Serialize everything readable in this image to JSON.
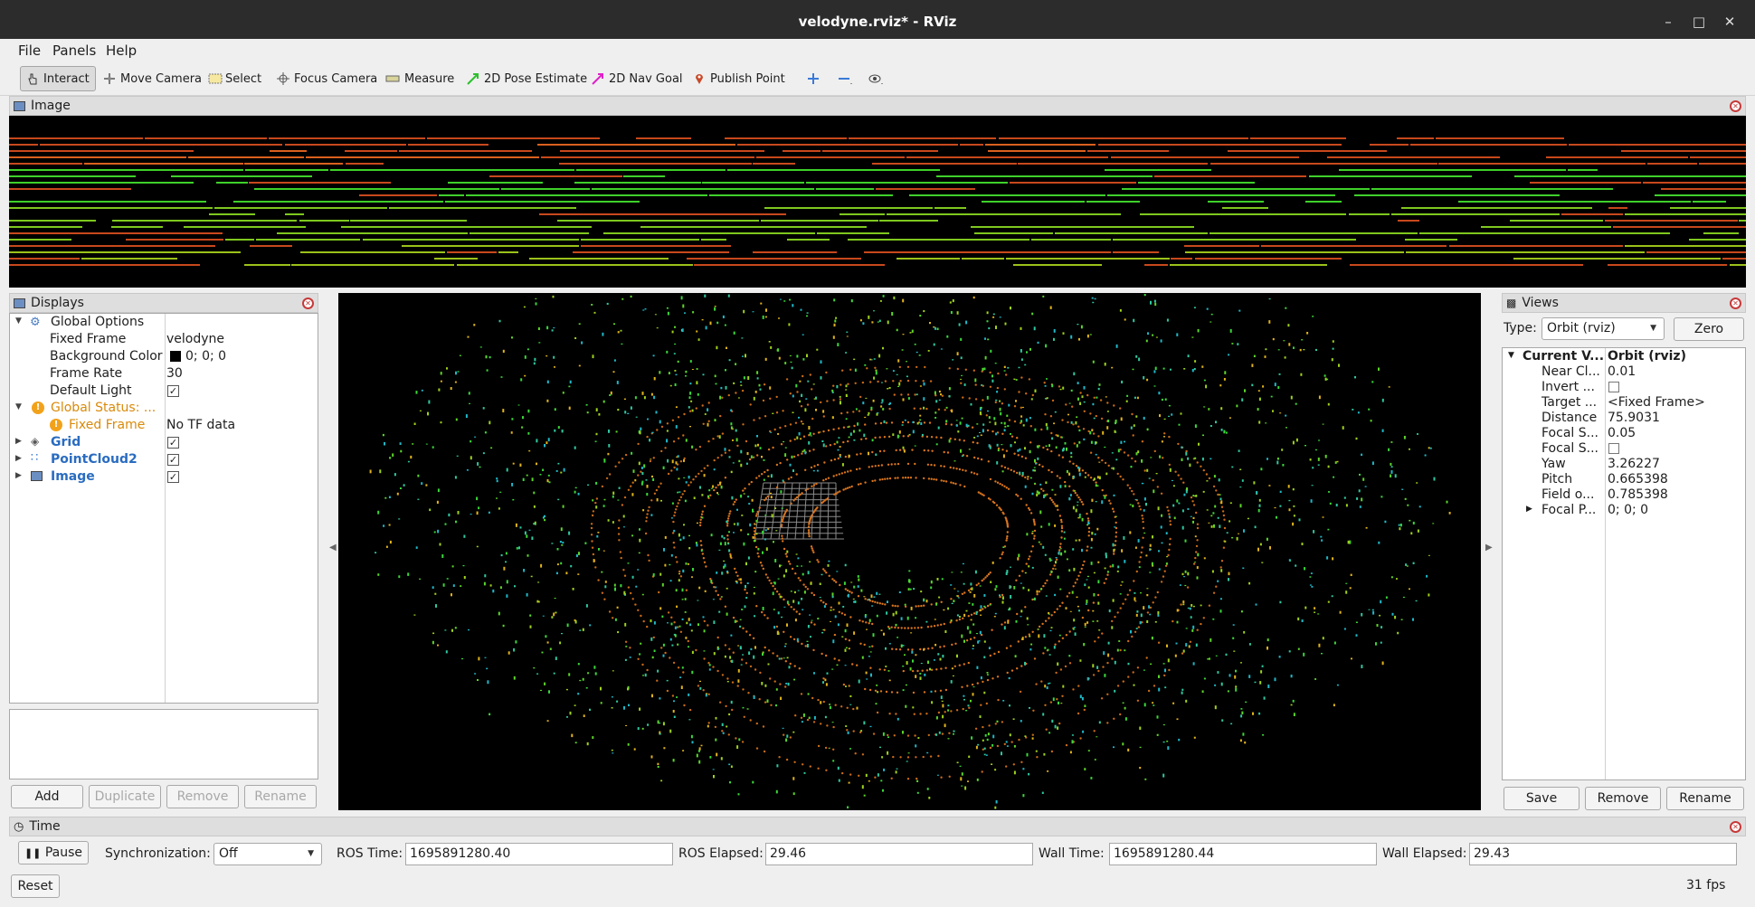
{
  "window": {
    "title": "velodyne.rviz* - RViz"
  },
  "menu": {
    "file": "File",
    "panels": "Panels",
    "help": "Help"
  },
  "toolbar": {
    "interact": "Interact",
    "move_camera": "Move Camera",
    "select": "Select",
    "focus_camera": "Focus Camera",
    "measure": "Measure",
    "pose_estimate": "2D Pose Estimate",
    "nav_goal": "2D Nav Goal",
    "publish_point": "Publish Point"
  },
  "image_panel": {
    "title": "Image"
  },
  "displays": {
    "title": "Displays",
    "global_options": "Global Options",
    "fixed_frame_label": "Fixed Frame",
    "fixed_frame_value": "velodyne",
    "bg_color_label": "Background Color",
    "bg_color_value": "0; 0; 0",
    "frame_rate_label": "Frame Rate",
    "frame_rate_value": "30",
    "default_light_label": "Default Light",
    "global_status": "Global Status: ...",
    "status_fixed_frame": "Fixed Frame",
    "status_value": "No TF data",
    "grid": "Grid",
    "pointcloud": "PointCloud2",
    "image": "Image",
    "buttons": {
      "add": "Add",
      "duplicate": "Duplicate",
      "remove": "Remove",
      "rename": "Rename"
    }
  },
  "views": {
    "title": "Views",
    "type_label": "Type:",
    "type_value": "Orbit (rviz)",
    "zero": "Zero",
    "current_label": "Current V...",
    "current_value": "Orbit (rviz)",
    "props": [
      {
        "label": "Near Cl...",
        "value": "0.01"
      },
      {
        "label": "Invert ...",
        "value": ""
      },
      {
        "label": "Target ...",
        "value": "<Fixed Frame>"
      },
      {
        "label": "Distance",
        "value": "75.9031"
      },
      {
        "label": "Focal S...",
        "value": "0.05"
      },
      {
        "label": "Focal S...",
        "value": ""
      },
      {
        "label": "Yaw",
        "value": "3.26227"
      },
      {
        "label": "Pitch",
        "value": "0.665398"
      },
      {
        "label": "Field o...",
        "value": "0.785398"
      },
      {
        "label": "Focal P...",
        "value": "0; 0; 0"
      }
    ],
    "buttons": {
      "save": "Save",
      "remove": "Remove",
      "rename": "Rename"
    }
  },
  "time": {
    "title": "Time",
    "pause": "Pause",
    "sync_label": "Synchronization:",
    "sync_value": "Off",
    "ros_time_label": "ROS Time:",
    "ros_time": "1695891280.40",
    "ros_elapsed_label": "ROS Elapsed:",
    "ros_elapsed": "29.46",
    "wall_time_label": "Wall Time:",
    "wall_time": "1695891280.44",
    "wall_elapsed_label": "Wall Elapsed:",
    "wall_elapsed": "29.43",
    "reset": "Reset",
    "fps": "31 fps"
  }
}
